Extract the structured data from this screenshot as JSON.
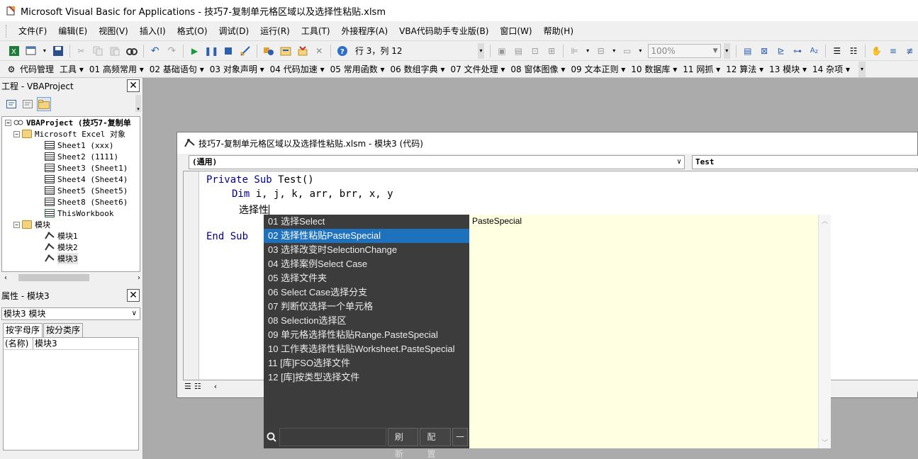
{
  "window": {
    "title": "Microsoft Visual Basic for Applications - 技巧7-复制单元格区域以及选择性粘贴.xlsm"
  },
  "menubar": {
    "items": [
      "文件(F)",
      "编辑(E)",
      "视图(V)",
      "插入(I)",
      "格式(O)",
      "调试(D)",
      "运行(R)",
      "工具(T)",
      "外接程序(A)",
      "VBA代码助手专业版(B)",
      "窗口(W)",
      "帮助(H)"
    ]
  },
  "toolbar": {
    "position": "行 3，列 12",
    "zoom": "100%"
  },
  "toolbar2": {
    "items": [
      "代码管理",
      "工具 ▾",
      "01 高频常用 ▾",
      "02 基础语句 ▾",
      "03 对象声明 ▾",
      "04 代码加速 ▾",
      "05 常用函数 ▾",
      "06 数组字典 ▾",
      "07 文件处理 ▾",
      "08 窗体图像 ▾",
      "09 文本正则 ▾",
      "10 数据库 ▾",
      "11 网抓 ▾",
      "12 算法 ▾",
      "13 模块 ▾",
      "14 杂项 ▾"
    ]
  },
  "project": {
    "title": "工程 - VBAProject",
    "root": "VBAProject (技巧7-复制单",
    "excel_objects": "Microsoft Excel 对象",
    "sheets": [
      "Sheet1 (xxx)",
      "Sheet2 (1111)",
      "Sheet3 (Sheet1)",
      "Sheet4 (Sheet4)",
      "Sheet5 (Sheet5)",
      "Sheet8 (Sheet6)",
      "ThisWorkbook"
    ],
    "modules_folder": "模块",
    "modules": [
      "模块1",
      "模块2",
      "模块3"
    ]
  },
  "properties": {
    "title": "属性 - 模块3",
    "object": "模块3 模块",
    "tabs": [
      "按字母序",
      "按分类序"
    ],
    "rows": [
      {
        "name": "(名称)",
        "value": "模块3"
      }
    ]
  },
  "code_window": {
    "title": "技巧7-复制单元格区域以及选择性粘贴.xlsm - 模块3 (代码)",
    "object_combo": "(通用)",
    "proc_combo": "Test",
    "lines": {
      "l1_kw": "Private Sub ",
      "l1_rest": "Test()",
      "l2_kw": "Dim ",
      "l2_rest": "i, j, k, arr, brr, x, y",
      "l3": "选择性",
      "l4": "End Sub"
    }
  },
  "autocomplete": {
    "items": [
      "01 选择Select",
      "02 选择性粘贴PasteSpecial",
      "03 选择改变时SelectionChange",
      "04 选择案例Select Case",
      "05 选择文件夹",
      "06 Select Case选择分支",
      "07 判断仅选择一个单元格",
      "08 Selection选择区",
      "09 单元格选择性粘贴Range.PasteSpecial",
      "10 工作表选择性粘贴Worksheet.PasteSpecial",
      "11 [库]FSO选择文件",
      "12 [库]按类型选择文件"
    ],
    "selected_index": 1,
    "detail": "PasteSpecial",
    "refresh_label": "刷新",
    "config_label": "配置",
    "minimize_label": "一",
    "selected_color": "#1e72bd",
    "detail_bg": "#ffffe1"
  }
}
